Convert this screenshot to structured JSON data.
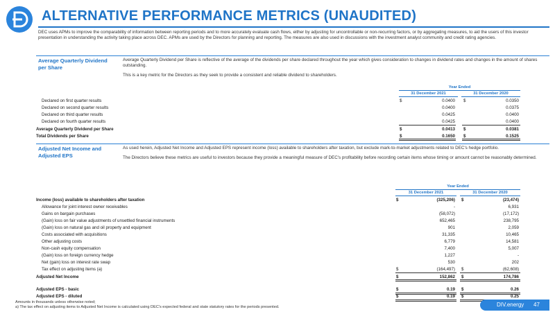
{
  "page": {
    "title": "ALTERNATIVE PERFORMANCE METRICS (UNAUDITED)",
    "intro": "DEC uses APMs to improve the comparability of information between reporting periods and to more accurately evaluate cash flows, either by adjusting for uncontrollable or non-recurring factors, or by aggregating measures, to aid the users of this investor presentation in understanding the activity taking place across DEC. APMs are used by the Directors for planning and reporting. The measures are also used in discussions with the investment analyst community and credit rating agencies.",
    "brand": "DIV.energy",
    "page_number": "47"
  },
  "section1": {
    "title": "Average Quarterly Dividend per Share",
    "para1": "Average Quarterly Dividend per Share is reflective of the average of the dividends per share declared throughout the year which gives consideration to changes in dividend rates and changes in the amount of shares outstanding.",
    "para2": "This is a key metric for the Directors as they seek to provide a consistent and reliable dividend to shareholders.",
    "year_ended": "Year Ended",
    "col1": "31 December 2021",
    "col2": "31 December 2020",
    "rows": [
      {
        "label": "Declared on first quarter results",
        "cur1": "$",
        "v1": "0.0400",
        "cur2": "$",
        "v2": "0.0350"
      },
      {
        "label": "Declared on second quarter results",
        "cur1": "",
        "v1": "0.0400",
        "cur2": "",
        "v2": "0.0375"
      },
      {
        "label": "Declared on third quarter results",
        "cur1": "",
        "v1": "0.0425",
        "cur2": "",
        "v2": "0.0400"
      },
      {
        "label": "Declared on fourth quarter results",
        "cur1": "",
        "v1": "0.0425",
        "cur2": "",
        "v2": "0.0400"
      },
      {
        "label": "Average Quarterly Dividend per Share",
        "cur1": "$",
        "v1": "0.0413",
        "cur2": "$",
        "v2": "0.0381"
      },
      {
        "label": "Total Dividends per Share",
        "cur1": "$",
        "v1": "0.1650",
        "cur2": "$",
        "v2": "0.1525"
      }
    ]
  },
  "section2": {
    "title": "Adjusted Net Income and Adjusted EPS",
    "para1": "As used herein, Adjusted Net Income and Adjusted EPS represent income (loss) available to shareholders after taxation, but exclude mark-to-market adjustments related to DEC's hedge portfolio.",
    "para2": "The Directors believe these metrics are useful to investors because they provide a meaningful measure of DEC's profitability before recording certain items whose timing or amount cannot be reasonably determined.",
    "year_ended": "Year Ended",
    "col1": "31 December 2021",
    "col2": "31 December 2020",
    "rows": [
      {
        "label": "Income (loss) available to shareholders after taxation",
        "cur1": "$",
        "v1": "(325,206)",
        "cur2": "$",
        "v2": "(23,474)"
      },
      {
        "label": "Allowance for joint interest owner receivables",
        "cur1": "",
        "v1": "-",
        "cur2": "",
        "v2": "6,931"
      },
      {
        "label": "Gains on bargain purchases",
        "cur1": "",
        "v1": "(58,072)",
        "cur2": "",
        "v2": "(17,172)"
      },
      {
        "label": "(Gain) loss on fair value adjustments of unsettled financial instruments",
        "cur1": "",
        "v1": "652,465",
        "cur2": "",
        "v2": "238,795"
      },
      {
        "label": "(Gain) loss on natural gas and oil property and equipment",
        "cur1": "",
        "v1": "901",
        "cur2": "",
        "v2": "2,059"
      },
      {
        "label": "Costs associated with acquisitions",
        "cur1": "",
        "v1": "31,335",
        "cur2": "",
        "v2": "10,465"
      },
      {
        "label": "Other adjusting costs",
        "cur1": "",
        "v1": "6,779",
        "cur2": "",
        "v2": "14,581"
      },
      {
        "label": "Non-cash equity compensation",
        "cur1": "",
        "v1": "7,400",
        "cur2": "",
        "v2": "5,007"
      },
      {
        "label": "(Gain) loss on foreign currency hedge",
        "cur1": "",
        "v1": "1,227",
        "cur2": "",
        "v2": "-"
      },
      {
        "label": "Net (gain) loss on interest rate swap",
        "cur1": "",
        "v1": "530",
        "cur2": "",
        "v2": "202"
      },
      {
        "label": "Tax effect on adjusting items (a)",
        "cur1": "$",
        "v1": "(164,497)",
        "cur2": "$",
        "v2": "(62,608)"
      },
      {
        "label": "Adjusted Net Income",
        "cur1": "$",
        "v1": "152,862",
        "cur2": "$",
        "v2": "174,786"
      },
      {
        "label": "Adjusted EPS - basic",
        "cur1": "$",
        "v1": "0.19",
        "cur2": "$",
        "v2": "0.26"
      },
      {
        "label": "Adjusted EPS - diluted",
        "cur1": "$",
        "v1": "0.19",
        "cur2": "$",
        "v2": "0.25"
      }
    ]
  },
  "footnotes": {
    "note1": "Amounts in thousands unless otherwise noted;",
    "note2": "a)   The tax effect on adjusting items to Adjusted Net Income is calculated using DEC's expected federal and state statutory rates for the periods presented."
  },
  "colors": {
    "accent": "#1f74c7",
    "brand_bar": "#2b84dc"
  }
}
